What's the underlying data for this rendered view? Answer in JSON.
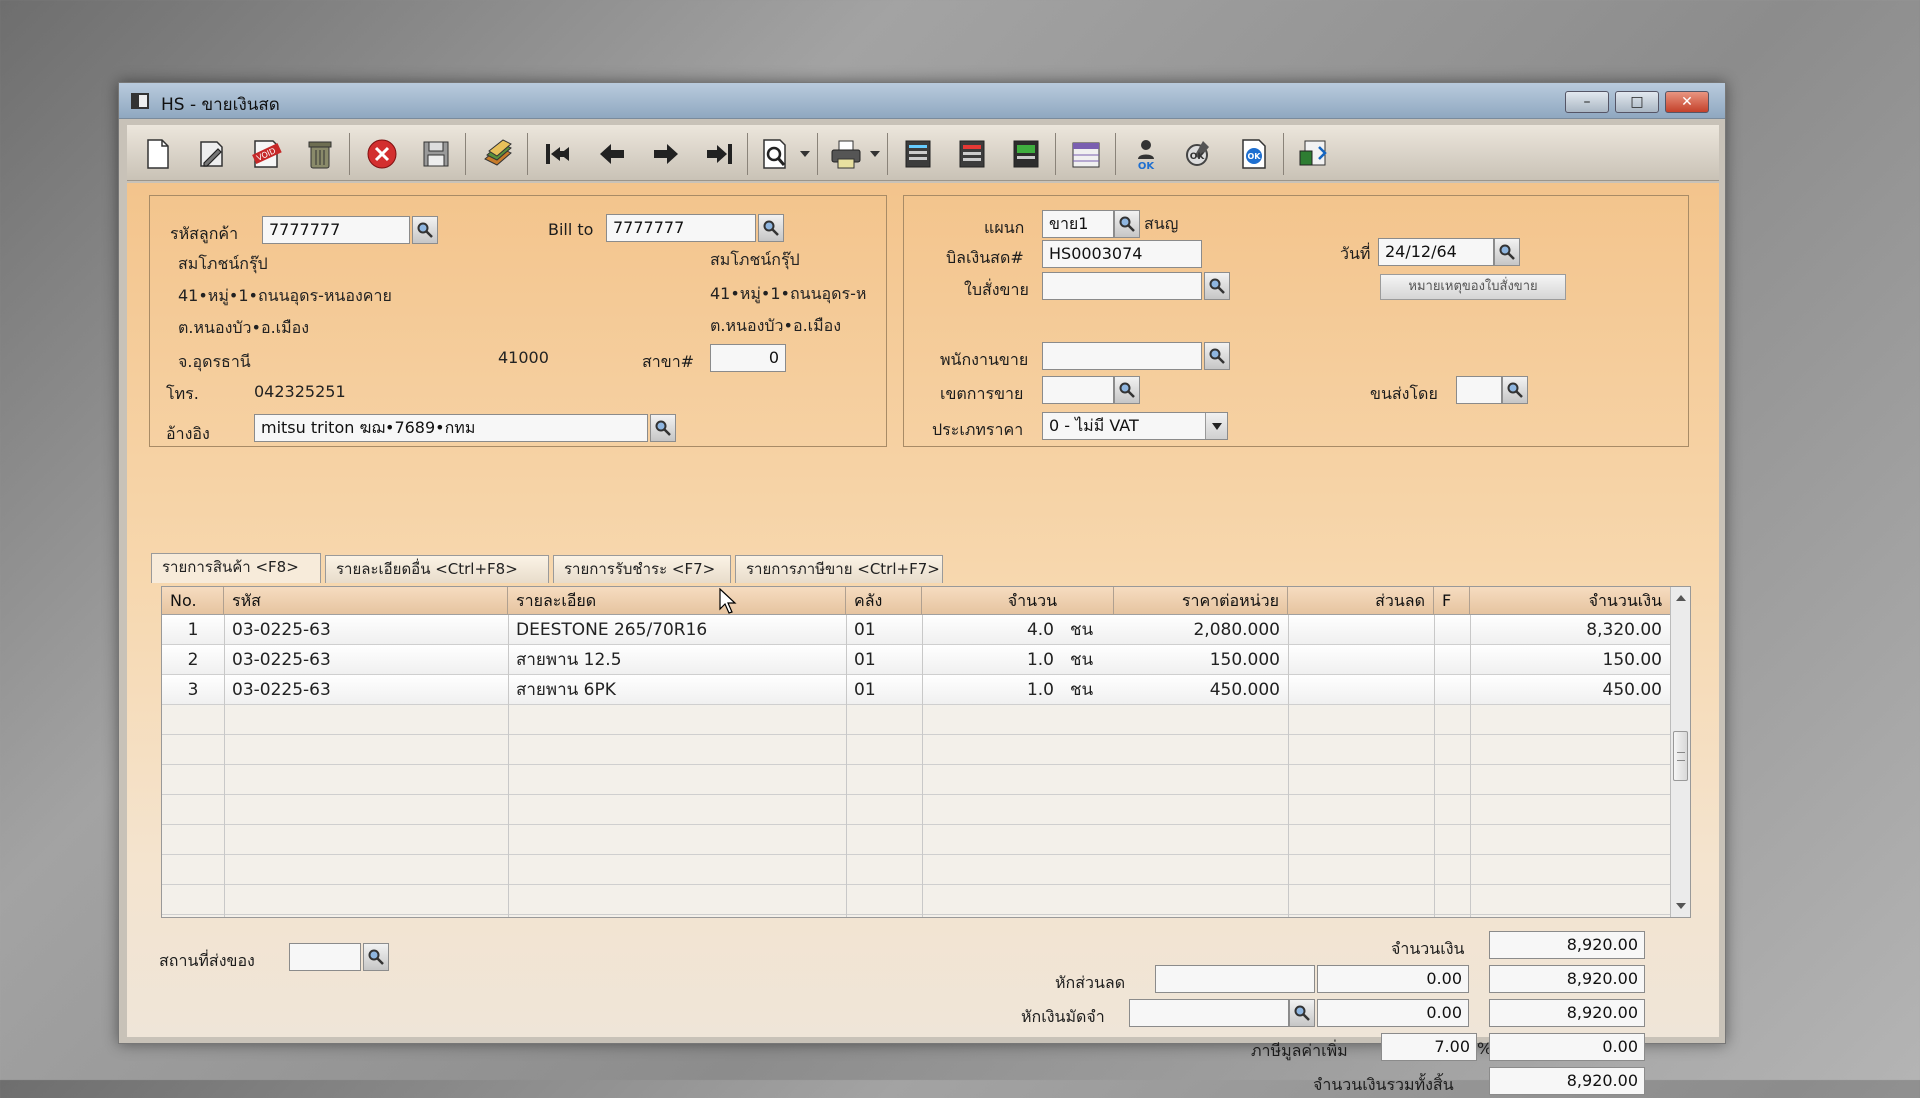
{
  "window": {
    "title": "HS - ขายเงินสด",
    "minimize_label": "–",
    "maximize_label": "□",
    "close_label": "✕"
  },
  "toolbar": {
    "buttons": [
      "new-document",
      "edit",
      "void",
      "delete",
      "cancel",
      "save",
      "copy",
      "first-record",
      "previous-record",
      "next-record",
      "last-record",
      "search",
      "print",
      "report-1",
      "report-2",
      "report-3",
      "report-4",
      "approve",
      "ok-check",
      "ok-document",
      "export"
    ]
  },
  "customer": {
    "code_label": "รหัสลูกค้า",
    "code": "7777777",
    "name": "สมโภชน์กรุ๊ป",
    "address1": "41•หมู่•1•ถนนอุดร-หนองคาย",
    "address2": "ต.หนองบัว•อ.เมือง",
    "province": "จ.อุดรธานี",
    "postcode": "41000",
    "phone_label": "โทร.",
    "phone": "042325251",
    "reference_label": "อ้างอิง",
    "reference": "mitsu triton ฆฌ•7689•กทม"
  },
  "billto": {
    "label": "Bill to",
    "code": "7777777",
    "name": "สมโภชน์กรุ๊ป",
    "address1": "41•หมู่•1•ถนนอุดร-ห",
    "address2": "ต.หนองบัว•อ.เมือง",
    "branch_label": "สาขา#",
    "branch": "0"
  },
  "doc": {
    "department_label": "แผนก",
    "department": "ขาย1",
    "department_name": "สนญ",
    "bill_label": "บิลเงินสด#",
    "bill_no": "HS0003074",
    "order_label": "ใบสั่งขาย",
    "order_no": "",
    "date_label": "วันที่",
    "date": "24/12/64",
    "order_note_button": "หมายเหตุของใบสั่งขาย",
    "salesperson_label": "พนักงานขาย",
    "salesperson": "",
    "area_label": "เขตการขาย",
    "area": "",
    "shipper_label": "ขนส่งโดย",
    "shipper": "",
    "price_type_label": "ประเภทราคา",
    "price_type": "0 - ไม่มี VAT"
  },
  "tabs": [
    {
      "label": "รายการสินค้า <F8>"
    },
    {
      "label": "รายละเอียดอื่น <Ctrl+F8>"
    },
    {
      "label": "รายการรับชำระ <F7>"
    },
    {
      "label": "รายการภาษีขาย <Ctrl+F7>"
    }
  ],
  "table": {
    "headers": {
      "no": "No.",
      "code": "รหัส",
      "desc": "รายละเอียด",
      "wh": "คลัง",
      "qty": "จำนวน",
      "price": "ราคาต่อหน่วย",
      "discount": "ส่วนลด",
      "f": "F",
      "amount": "จำนวนเงิน"
    },
    "rows": [
      {
        "no": "1",
        "code": "03-0225-63",
        "desc": "DEESTONE 265/70R16",
        "wh": "01",
        "qty": "4.0",
        "unit": "ชน",
        "price": "2,080.000",
        "discount": "",
        "f": "",
        "amount": "8,320.00"
      },
      {
        "no": "2",
        "code": "03-0225-63",
        "desc": "สายพาน 12.5",
        "wh": "01",
        "qty": "1.0",
        "unit": "ชน",
        "price": "150.000",
        "discount": "",
        "f": "",
        "amount": "150.00"
      },
      {
        "no": "3",
        "code": "03-0225-63",
        "desc": "สายพาน 6PK",
        "wh": "01",
        "qty": "1.0",
        "unit": "ชน",
        "price": "450.000",
        "discount": "",
        "f": "",
        "amount": "450.00"
      }
    ]
  },
  "footer": {
    "delivery_label": "สถานที่ส่งของ",
    "delivery": "",
    "amount_label": "จำนวนเงิน",
    "amount": "8,920.00",
    "discount_label": "หักส่วนลด",
    "discount_input": "",
    "discount_value": "0.00",
    "discount_total": "8,920.00",
    "deposit_label": "หักเงินมัดจำ",
    "deposit_input": "",
    "deposit_value": "0.00",
    "deposit_total": "8,920.00",
    "vat_label": "ภาษีมูลค่าเพิ่ม",
    "vat_rate": "7.00",
    "vat_percent": "%",
    "vat_value": "0.00",
    "grand_label": "จำนวนเงินรวมทั้งสิ้น",
    "grand_total": "8,920.00"
  }
}
